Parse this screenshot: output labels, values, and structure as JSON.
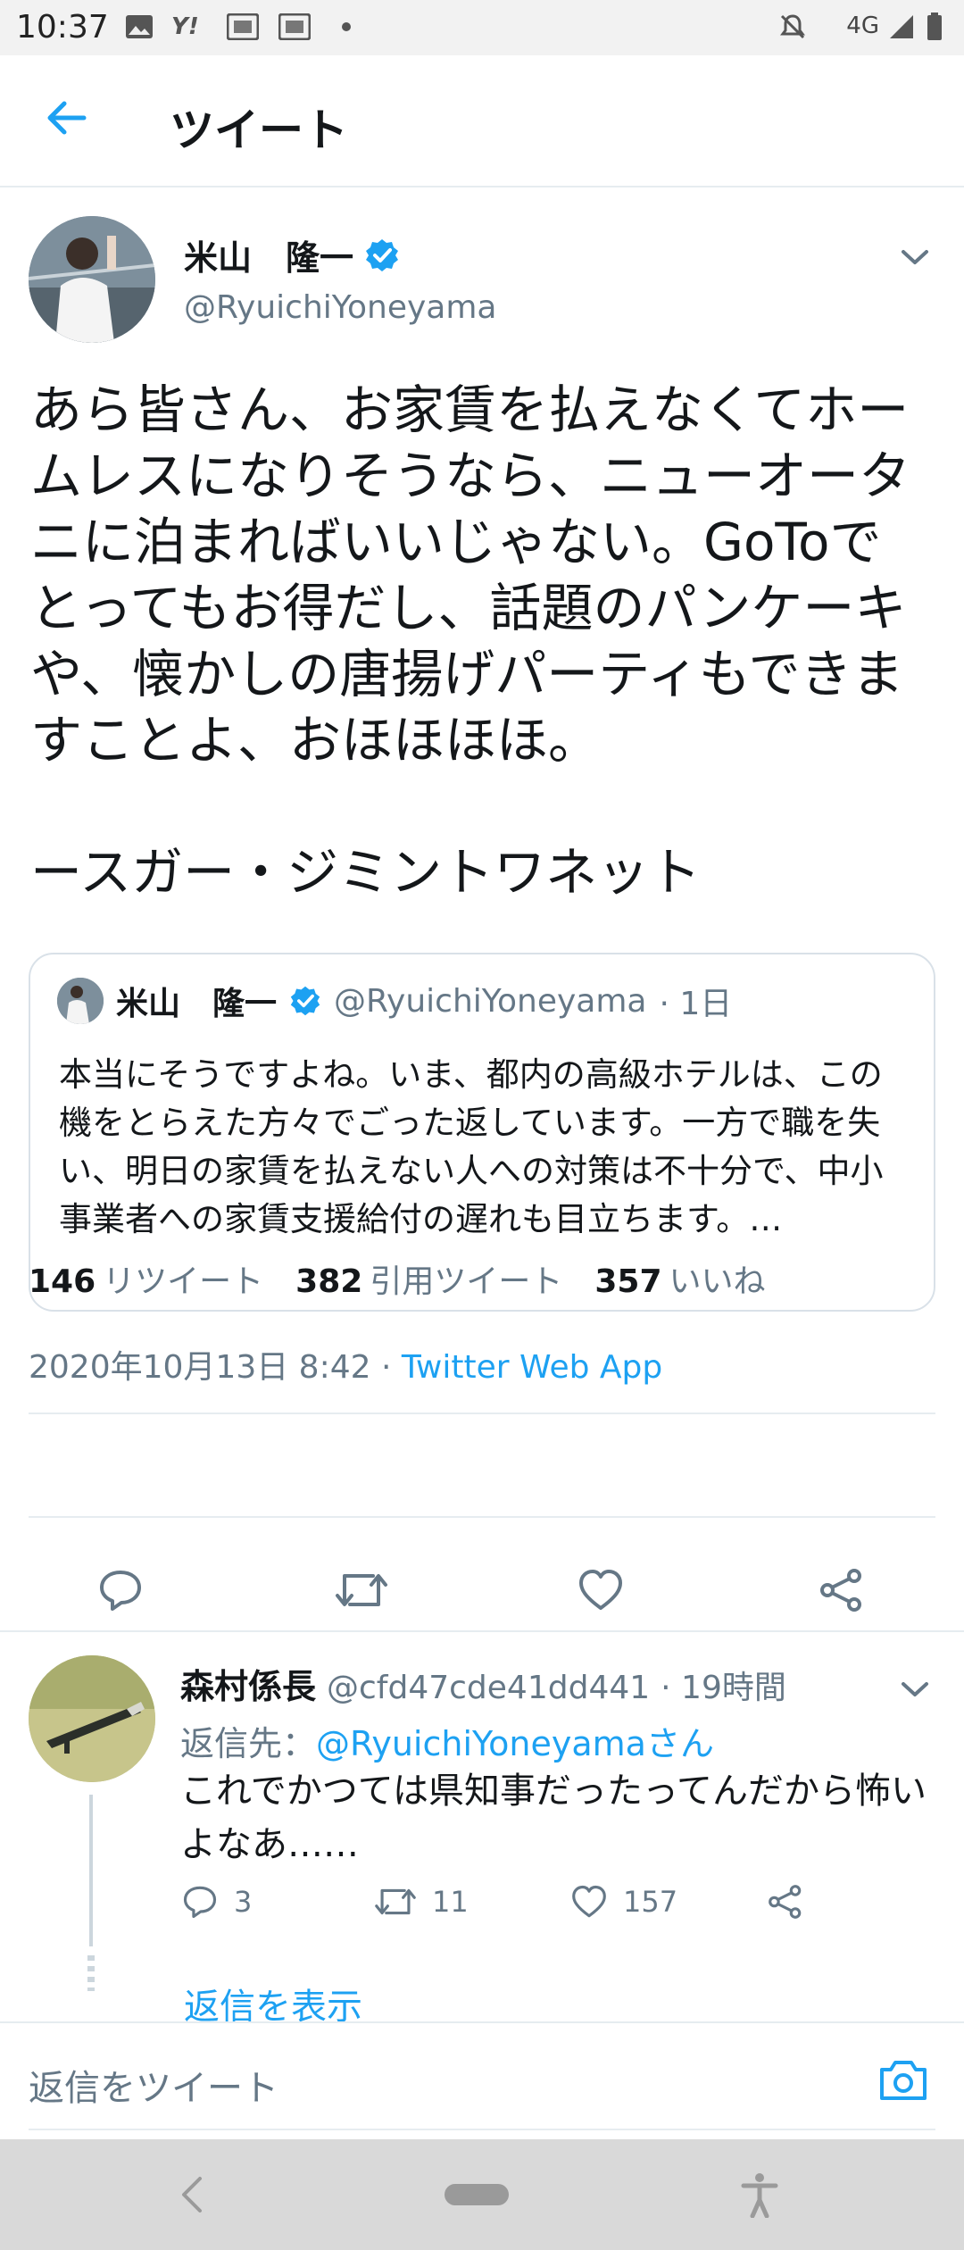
{
  "status_bar": {
    "time": "10:37",
    "network": "4G",
    "icons": [
      "image-icon",
      "yahoo-icon",
      "au-icon",
      "au-icon",
      "dot-icon",
      "mute-icon",
      "signal-icon",
      "battery-icon"
    ]
  },
  "header": {
    "title": "ツイート"
  },
  "tweet": {
    "author_name": "米山　隆一",
    "author_handle": "@RyuichiYoneyama",
    "verified": true,
    "text": "あら皆さん、お家賃を払えなくてホームレスになりそうなら、ニューオータニに泊まればいいじゃない。GoToでとってもお得だし、話題のパンケーキや、懐かしの唐揚げパーティもできますことよ、おほほほほ。\n\nースガー・ジミントワネット",
    "quote": {
      "author_name": "米山　隆一",
      "author_handle": "@RyuichiYoneyama",
      "time": "· 1日",
      "text": "本当にそうですよね。いま、都内の高級ホテルは、この機をとらえた方々でごった返しています。一方で職を失い、明日の家賃を払えない人への対策は不十分で、中小事業者への家賃支援給付の遅れも目立ちます。…"
    },
    "timestamp": "2020年10月13日 8:42 · ",
    "source": "Twitter Web App",
    "stats": {
      "retweets_count": "146",
      "retweets_label": "リツイート",
      "quotes_count": "382",
      "quotes_label": "引用ツイート",
      "likes_count": "357",
      "likes_label": "いいね"
    }
  },
  "reply": {
    "author_name": "森村係長",
    "author_handle": "@cfd47cde41dd441",
    "time": "· 19時間",
    "reply_to_label": "返信先：",
    "reply_to_user": "@RyuichiYoneyamaさん",
    "text": "これでかつては県知事だったってんだから怖いよなあ……",
    "reply_count": "3",
    "retweet_count": "11",
    "like_count": "157",
    "show_replies": "返信を表示"
  },
  "compose": {
    "placeholder": "返信をツイート"
  },
  "colors": {
    "accent": "#1da1f2",
    "secondary_text": "#657786",
    "primary_text": "#14171a"
  }
}
